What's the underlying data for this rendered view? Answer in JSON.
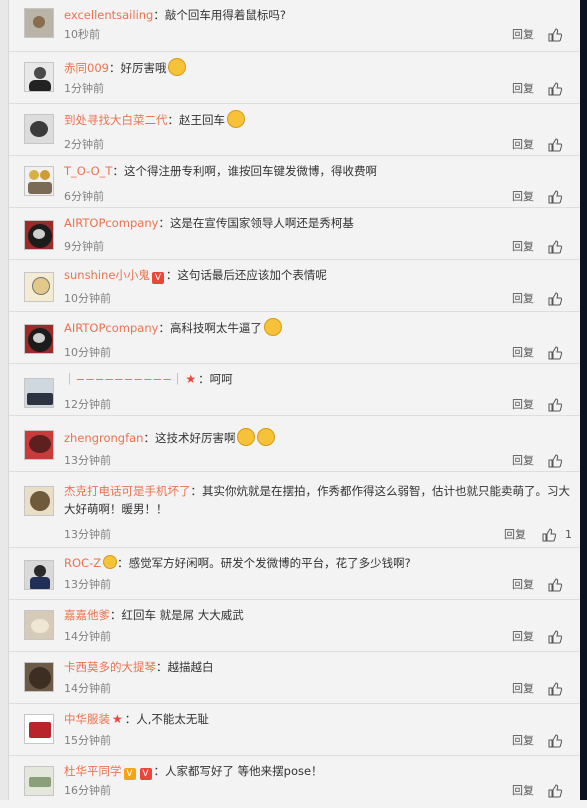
{
  "reply_label": "回复",
  "comments": [
    {
      "user": "excellentsailing",
      "text": "敲个回车用得着鼠标吗?",
      "time": "10秒前"
    },
    {
      "user": "赤同009",
      "text": "好厉害哦",
      "time": "1分钟前"
    },
    {
      "user": "到处寻找大白菜二代",
      "text": "赵王回车",
      "time": "2分钟前"
    },
    {
      "user": "T_O-O_T",
      "text": "这个得注册专利啊，谁按回车键发微博，得收费啊",
      "time": "6分钟前"
    },
    {
      "user": "AIRTOPcompany",
      "text": "这是在宣传国家领导人啊还是秀柯基",
      "time": "9分钟前"
    },
    {
      "user": "sunshine小小鬼",
      "text": "这句话最后还应该加个表情呢",
      "time": "10分钟前"
    },
    {
      "user": "AIRTOPcompany",
      "text": "高科技啊太牛逼了",
      "time": "10分钟前"
    },
    {
      "user": "｜−−−−−−−−−−｜",
      "text": "呵呵",
      "time": "12分钟前"
    },
    {
      "user": "zhengrongfan",
      "text": "这技术好厉害啊",
      "time": "13分钟前"
    },
    {
      "user": "杰克打电话可是手机坏了",
      "text": "其实你炕就是在摆拍，作秀都作得这么弱智，估计也就只能卖萌了。习大大好萌啊！暖男！！",
      "time": "13分钟前",
      "likes": "1"
    },
    {
      "user": "ROC-Z",
      "text": "感觉军方好闲啊。研发个发微博的平台，花了多少钱啊?",
      "time": "13分钟前"
    },
    {
      "user": "嘉嘉他爹",
      "text": "红回车 就是屌 大大威武",
      "time": "14分钟前"
    },
    {
      "user": "卡西莫多的大提琴",
      "text": "越描越白",
      "time": "14分钟前"
    },
    {
      "user": "中华服装",
      "text": "人,不能太无耻",
      "time": "15分钟前"
    },
    {
      "user": "杜华平同学",
      "text": "人家都写好了 等他来摆pose！",
      "time": "16分钟前"
    }
  ],
  "colors": {
    "username": "#eb7350",
    "time": "#808080",
    "background": "#f3f3f3"
  },
  "icons": {
    "like": "thumbs-up-icon",
    "verified": "vip-badge-icon",
    "star": "star-icon",
    "emoji": "emoji-icon"
  }
}
